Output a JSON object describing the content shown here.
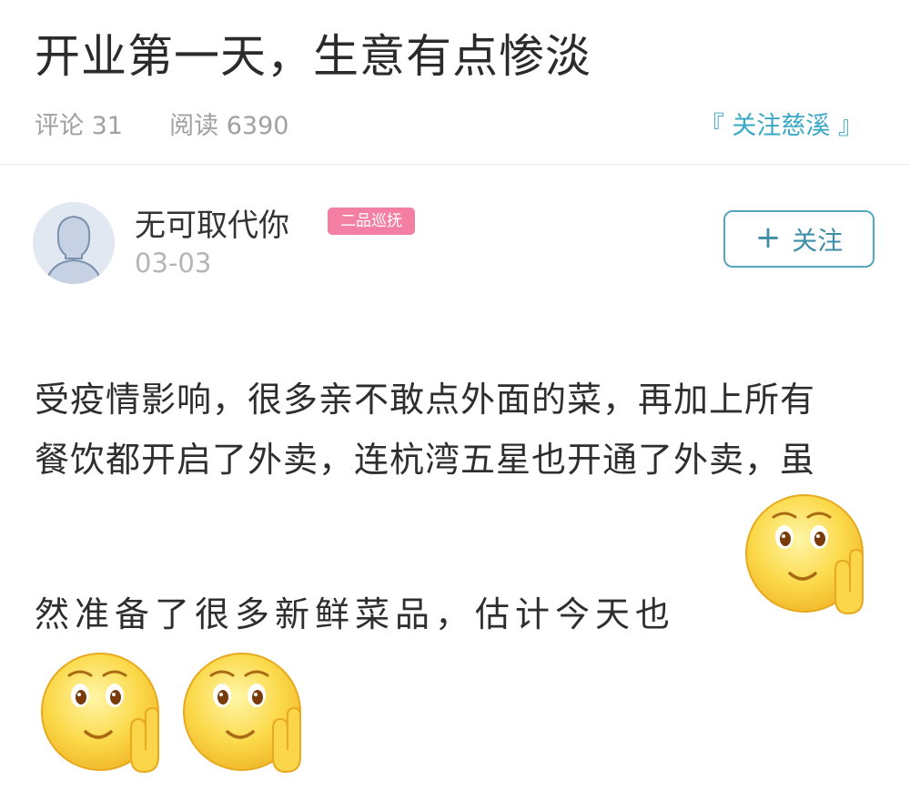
{
  "post": {
    "title": "开业第一天，生意有点惨淡",
    "comments_label": "评论 31",
    "reads_label": "阅读 6390",
    "follow_author_link": "『 关注慈溪 』"
  },
  "author": {
    "name": "无可取代你",
    "badge": "二品巡抚",
    "date": "03-03",
    "follow_button_label": "关注",
    "follow_button_icon": "plus-icon"
  },
  "content": {
    "lines": [
      "受疫情影响，很多亲不敢点外面的菜，再加上所有",
      "餐饮都开启了外卖，连杭湾五星也开通了外卖，虽",
      "然准备了很多新鲜菜品，估计今天也"
    ],
    "emojis": [
      "salute-emoji",
      "salute-emoji",
      "salute-emoji"
    ]
  },
  "colors": {
    "accent": "#3aa7c6",
    "badge_bg": "#f37fa5",
    "muted_text": "#a0a0a0"
  }
}
